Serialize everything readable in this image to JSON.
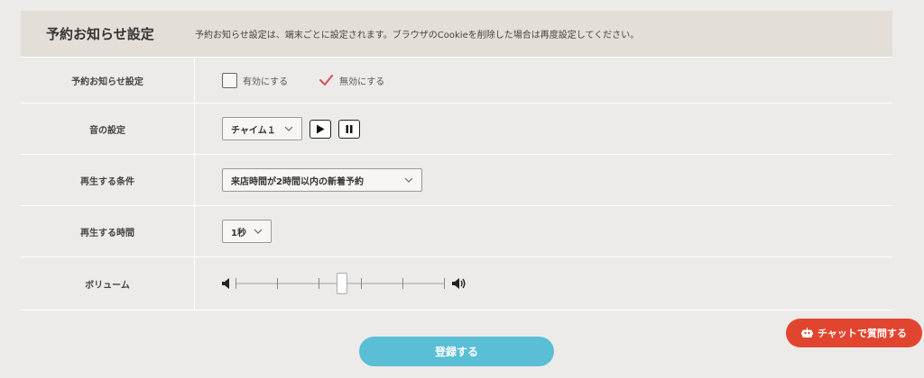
{
  "header": {
    "title": "予約お知らせ設定",
    "description": "予約お知らせ設定は、端末ごとに設定されます。ブラウザのCookieを削除した場合は再度設定してください。"
  },
  "rows": {
    "notify": {
      "label": "予約お知らせ設定",
      "enable_label": "有効にする",
      "disable_label": "無効にする",
      "selected": "disable"
    },
    "sound": {
      "label": "音の設定",
      "selected": "チャイム１"
    },
    "condition": {
      "label": "再生する条件",
      "selected": "来店時間が2時間以内の新着予約"
    },
    "duration": {
      "label": "再生する時間",
      "selected": "1秒"
    },
    "volume": {
      "label": "ボリューム",
      "level_fraction": 0.5
    }
  },
  "submit_label": "登録する",
  "chat_label": "チャットで質問する",
  "icons": [
    "play-icon",
    "pause-icon",
    "chevron-down-icon",
    "volume-low-icon",
    "volume-high-icon",
    "robot-icon",
    "checkmark-icon"
  ],
  "colors": {
    "header_bg": "#e3dfd8",
    "page_bg": "#edebe9",
    "submit_bg": "#59bed6",
    "chat_bg": "#e2452f",
    "check_accent": "#d9545d"
  }
}
